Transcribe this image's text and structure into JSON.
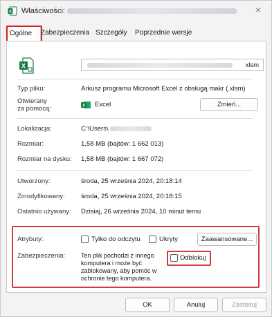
{
  "window": {
    "title_prefix": "Właściwości:",
    "close_glyph": "×"
  },
  "tabs": [
    {
      "label": "Ogólne"
    },
    {
      "label": "Zabezpieczenia"
    },
    {
      "label": "Szczegóły"
    },
    {
      "label": "Poprzednie wersje"
    }
  ],
  "file": {
    "ext": "xlsm"
  },
  "rows": {
    "type_label": "Typ pliku:",
    "type_value": "Arkusz programu Microsoft Excel z obsługą makr (.xlsm)",
    "opens_label_1": "Otwierany",
    "opens_label_2": "za pomocą:",
    "opens_value": "Excel",
    "change_button": "Zmień...",
    "location_label": "Lokalizacja:",
    "location_value": "C:\\Users\\",
    "size_label": "Rozmiar:",
    "size_value": "1,58 MB (bajtów: 1 662 013)",
    "disk_label": "Rozmiar na dysku:",
    "disk_value": "1,58 MB (bajtów: 1 667 072)",
    "created_label": "Utworzony:",
    "created_value": "środa, 25 września 2024, 20:18:14",
    "modified_label": "Zmodyfikowany:",
    "modified_value": "środa, 25 września 2024, 20:18:15",
    "accessed_label": "Ostatnio używany:",
    "accessed_value": "Dzisiaj, 26 września 2024, 10 minut temu"
  },
  "attributes": {
    "label": "Atrybuty:",
    "readonly": "Tylko do odczytu",
    "hidden": "Ukryty",
    "advanced_button": "Zaawansowane...",
    "security_label": "Zabezpieczenia:",
    "security_text": "Ten plik pochodzi z innego komputera i może być zablokowany, aby pomóc w ochronie tego komputera.",
    "unblock": "Odblokuj"
  },
  "footer": {
    "ok": "OK",
    "cancel": "Anuluj",
    "apply": "Zastosuj"
  },
  "colors": {
    "highlight": "#d32020",
    "excel_green": "#1d7a44"
  }
}
